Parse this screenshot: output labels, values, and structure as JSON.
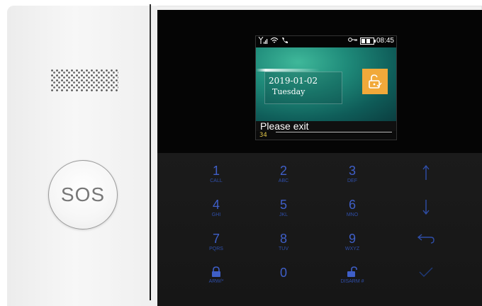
{
  "device": {
    "sos_label": "SOS"
  },
  "screen": {
    "time": "08:45",
    "date": "2019-01-02",
    "weekday": "Tuesday",
    "message": "Please exit",
    "countdown": "34"
  },
  "keypad": {
    "keys": [
      {
        "num": "1",
        "sub": "CALL"
      },
      {
        "num": "2",
        "sub": "ABC"
      },
      {
        "num": "3",
        "sub": "DEF"
      },
      {
        "num": "4",
        "sub": "GHI"
      },
      {
        "num": "5",
        "sub": "JKL"
      },
      {
        "num": "6",
        "sub": "MNO"
      },
      {
        "num": "7",
        "sub": "PQRS"
      },
      {
        "num": "8",
        "sub": "TUV"
      },
      {
        "num": "9",
        "sub": "WXYZ"
      },
      {
        "num": "0",
        "sub": ""
      }
    ],
    "arm_label": "ARW/*",
    "disarm_label": "DISARM #"
  },
  "colors": {
    "key_blue": "#3f5fc8",
    "lock_orange": "#f1a93a"
  },
  "icons": {
    "up": "arrow-up-icon",
    "down": "arrow-down-icon",
    "back": "back-arrow-icon",
    "ok": "check-icon"
  }
}
